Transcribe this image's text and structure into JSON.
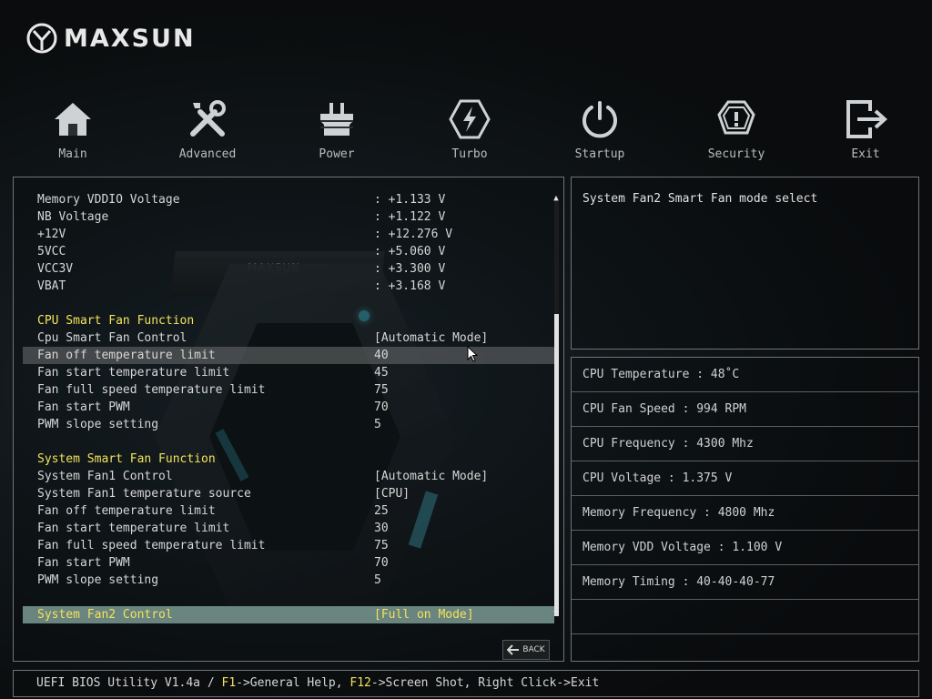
{
  "brand": {
    "name": "MAXSUN"
  },
  "nav": [
    {
      "label": "Main",
      "icon": "home-icon"
    },
    {
      "label": "Advanced",
      "icon": "tools-icon"
    },
    {
      "label": "Power",
      "icon": "power-chip-icon"
    },
    {
      "label": "Turbo",
      "icon": "lightning-icon"
    },
    {
      "label": "Startup",
      "icon": "power-button-icon"
    },
    {
      "label": "Security",
      "icon": "shield-icon"
    },
    {
      "label": "Exit",
      "icon": "exit-icon"
    }
  ],
  "rows": [
    {
      "label": "Memory VDDIO Voltage",
      "value": ": +1.133 V"
    },
    {
      "label": "NB Voltage",
      "value": ": +1.122 V"
    },
    {
      "label": "+12V",
      "value": ": +12.276 V"
    },
    {
      "label": "5VCC",
      "value": ": +5.060 V"
    },
    {
      "label": "VCC3V",
      "value": ": +3.300 V"
    },
    {
      "label": "VBAT",
      "value": ": +3.168 V"
    },
    {
      "label": "CPU Smart Fan Function",
      "value": ""
    },
    {
      "label": "Cpu Smart Fan Control",
      "value": "[Automatic Mode]"
    },
    {
      "label": "Fan off temperature limit",
      "value": "40"
    },
    {
      "label": "Fan start temperature limit",
      "value": "45"
    },
    {
      "label": "Fan full speed temperature limit",
      "value": "75"
    },
    {
      "label": "Fan start PWM",
      "value": "70"
    },
    {
      "label": "PWM slope setting",
      "value": "5"
    },
    {
      "label": "System Smart Fan Function",
      "value": ""
    },
    {
      "label": "System Fan1 Control",
      "value": "[Automatic Mode]"
    },
    {
      "label": "System Fan1 temperature source",
      "value": "[CPU]"
    },
    {
      "label": "Fan off temperature limit",
      "value": "25"
    },
    {
      "label": "Fan start temperature limit",
      "value": "30"
    },
    {
      "label": "Fan full speed temperature limit",
      "value": "75"
    },
    {
      "label": "Fan start PWM",
      "value": "70"
    },
    {
      "label": "PWM slope setting",
      "value": "5"
    },
    {
      "label": "System Fan2 Control",
      "value": "[Full on Mode]"
    }
  ],
  "back_label": "BACK",
  "help_text": "System Fan2 Smart Fan mode select",
  "info": [
    "CPU Temperature : 48˚C",
    "CPU Fan Speed : 994 RPM",
    "CPU Frequency : 4300 Mhz",
    "CPU Voltage : 1.375 V",
    "Memory Frequency : 4800 Mhz",
    "Memory VDD Voltage : 1.100 V",
    "Memory Timing : 40-40-40-77",
    "",
    ""
  ],
  "footer": {
    "prefix": "UEFI BIOS Utility V1.4a / ",
    "k1": "F1",
    "t1": "->General Help, ",
    "k2": "F12",
    "t2": "->Screen Shot, Right Click->Exit"
  },
  "watermark": "MAXSUN",
  "colors": {
    "accent": "#f3e35a",
    "selected_bg": "#6a8580",
    "highlight_bg": "#5a5c5e"
  }
}
